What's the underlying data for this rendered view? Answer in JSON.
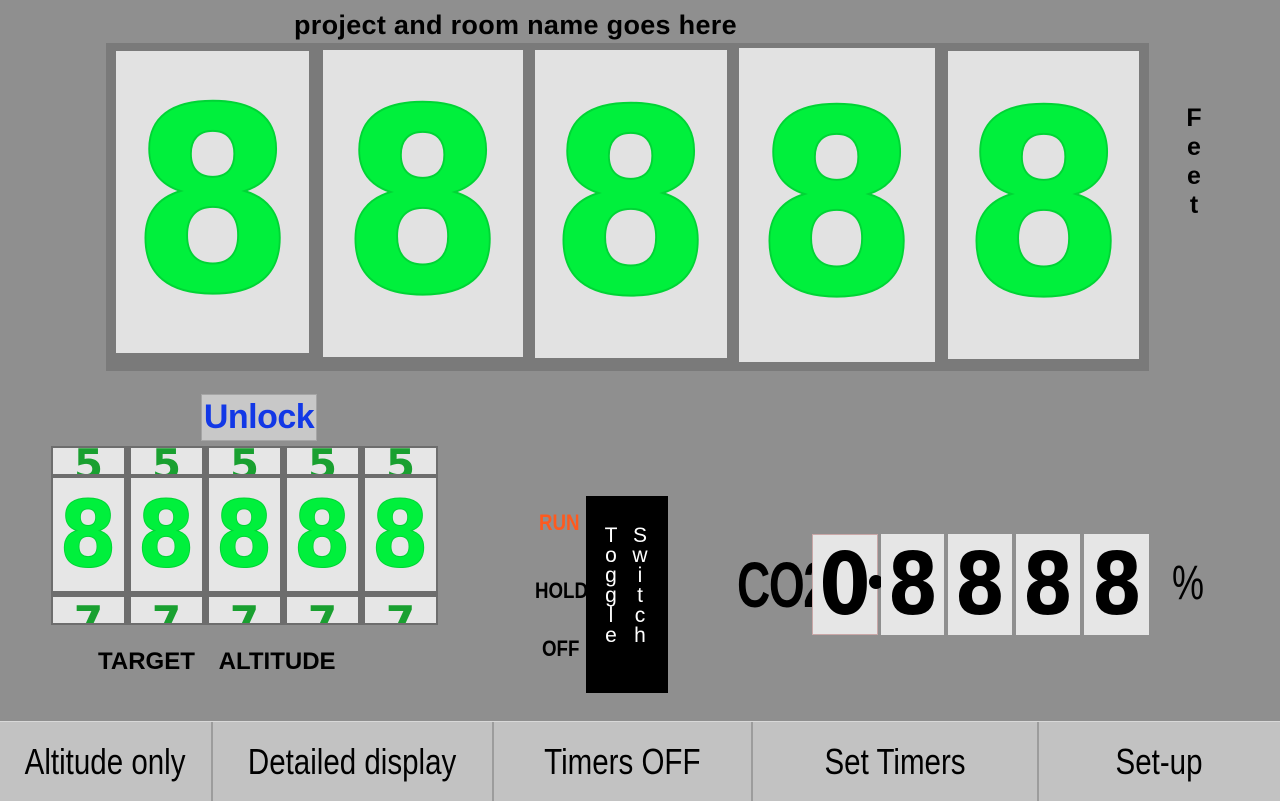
{
  "header": {
    "title": "project  and room name goes here"
  },
  "altitude": {
    "digits": [
      "8",
      "8",
      "8",
      "8",
      "8"
    ],
    "unit": "Feet"
  },
  "target": {
    "unlock_label": "Unlock",
    "digits_prev": [
      "5",
      "5",
      "5",
      "5",
      "5"
    ],
    "digits": [
      "8",
      "8",
      "8",
      "8",
      "8"
    ],
    "digits_next": [
      "7",
      "7",
      "7",
      "7",
      "7"
    ],
    "label": "TARGET ALTITUDE"
  },
  "toggle": {
    "run_label": "RUN",
    "hold_label": "HOLD",
    "off_label": "OFF",
    "word1": "Toggle",
    "word2": "Switch"
  },
  "co2": {
    "label": "CO2",
    "digits": [
      "0",
      "8",
      "8",
      "8",
      "8"
    ],
    "unit": "%"
  },
  "bottom_bar": {
    "altitude_only": "Altitude only",
    "detailed_display": "Detailed display",
    "timers_off": "Timers OFF",
    "set_timers": "Set Timers",
    "setup": "Set-up"
  },
  "colors": {
    "digit_green": "#00f03c",
    "unlock_blue": "#1238e6",
    "run_orange": "#ff5a1e"
  }
}
